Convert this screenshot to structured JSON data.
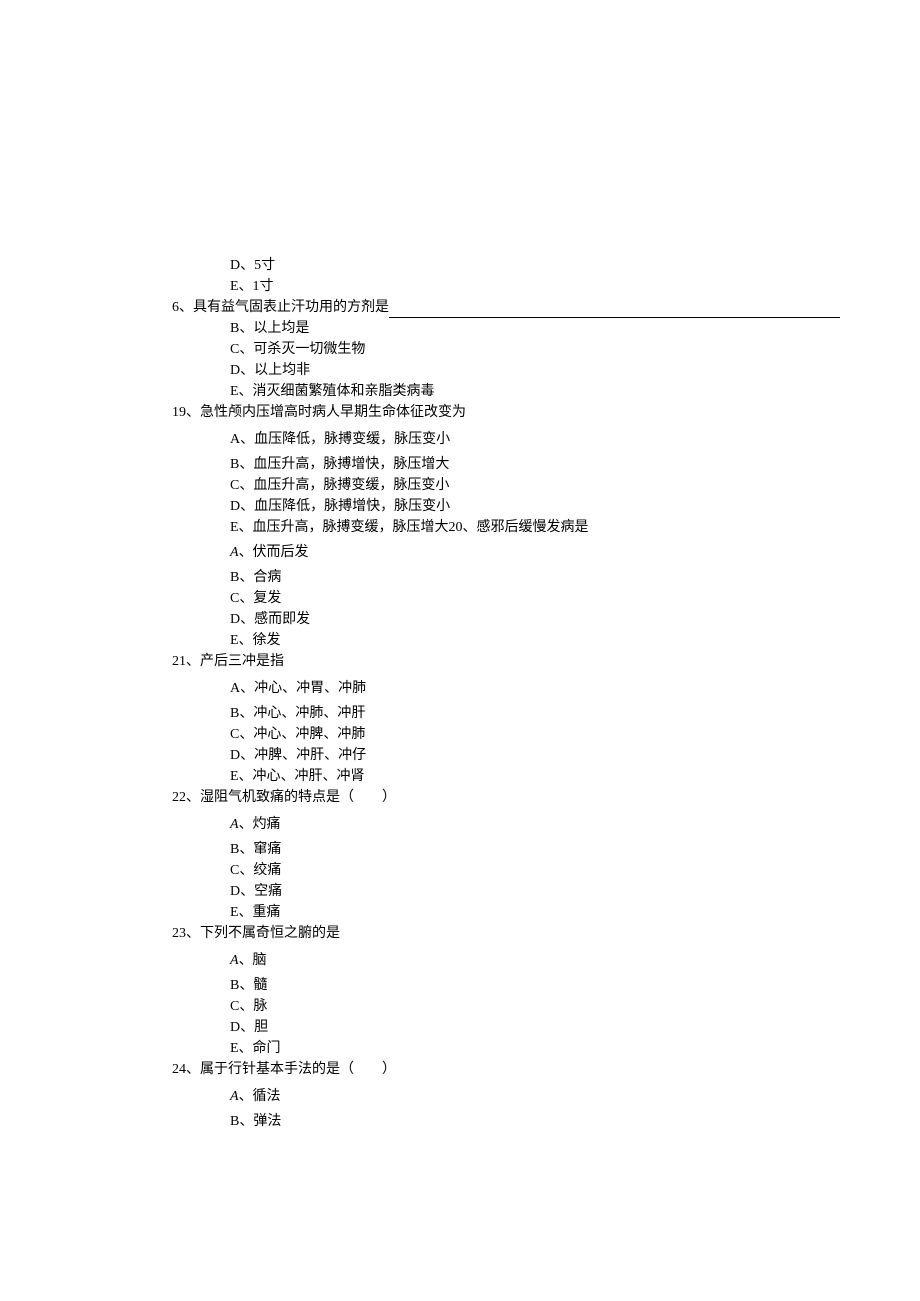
{
  "top_options": {
    "d": "D、5寸",
    "e": "E、1寸"
  },
  "q6": {
    "text": "6、具有益气固表止汗功用的方剂是"
  },
  "q18_options": {
    "b": "B、以上均是",
    "c": "C、可杀灭一切微生物",
    "d": "D、以上均非",
    "e": "E、消灭细菌繁殖体和亲脂类病毒"
  },
  "q19": {
    "text": "19、急性颅内压增高时病人早期生命体征改变为",
    "a": "A、血压降低，脉搏变缓，脉压变小",
    "b": "B、血压升高，脉搏增快，脉压增大",
    "c": "C、血压升高，脉搏变缓，脉压变小",
    "d": "D、血压降低，脉搏增快，脉压变小",
    "e": "E、血压升高，脉搏变缓，脉压增大20、感邪后缓慢发病是"
  },
  "q20": {
    "a_prefix": "A",
    "a_rest": "、伏而后发",
    "b": "B、合病",
    "c": "C、复发",
    "d": "D、感而即发",
    "e": "E、徐发"
  },
  "q21": {
    "text": "21、产后三冲是指",
    "a": "A、冲心、冲胃、冲肺",
    "b": "B、冲心、冲肺、冲肝",
    "c": "C、冲心、冲脾、冲肺",
    "d": "D、冲脾、冲肝、冲仔",
    "e": "E、冲心、冲肝、冲肾"
  },
  "q22": {
    "text": "22、湿阻气机致痛的特点是（　　）",
    "a_prefix": "A",
    "a_rest": "、灼痛",
    "b": "B、窜痛",
    "c": "C、绞痛",
    "d": "D、空痛",
    "e": "E、重痛"
  },
  "q23": {
    "text": "23、下列不属奇恒之腑的是",
    "a_prefix": "A",
    "a_rest": "、脑",
    "b": "B、髓",
    "c": "C、脉",
    "d": "D、胆",
    "e": "E、命门"
  },
  "q24": {
    "text": "24、属于行针基本手法的是（　　）",
    "a_prefix": "A",
    "a_rest": "、循法",
    "b": "B、弹法"
  }
}
